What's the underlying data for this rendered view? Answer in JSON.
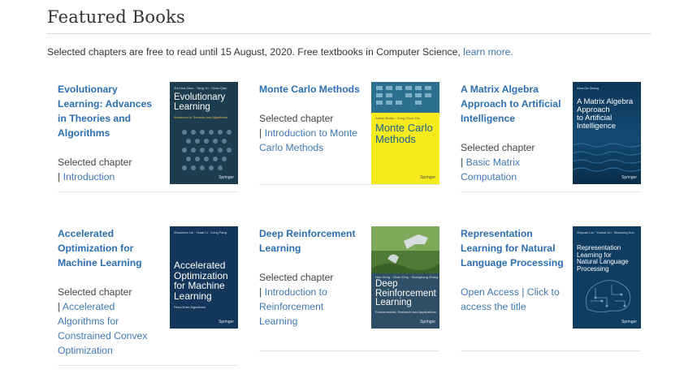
{
  "page": {
    "title": "Featured Books",
    "intro_text": "Selected chapters are free to read until 15 August, 2020.  Free textbooks in Computer Science, ",
    "intro_link": "learn more."
  },
  "books": [
    {
      "title_lines": [
        "Evolutionary",
        "Learning: Advances",
        "in Theories and",
        "Algorithms"
      ],
      "prefix": "Selected chapter",
      "pipe": "| ",
      "link_lines": [
        "Introduction"
      ],
      "cover": {
        "authors": "Zhi-Hua Zhou · Yang Yu · Chao Qian",
        "title_lines": [
          "Evolutionary",
          "Learning"
        ],
        "subtitle": "Advances in Theories and Algorithms",
        "publisher": "Springer",
        "color": "#1d3c4e",
        "icon": "evolutionary-dots-pattern"
      }
    },
    {
      "title_lines": [
        "Monte Carlo Methods"
      ],
      "prefix": "Selected chapter",
      "pipe": "| ",
      "link_lines": [
        "Introduction to Monte",
        "Carlo Methods"
      ],
      "cover": {
        "authors": "Adrian Barbu · Song-Chun Zhu",
        "title_lines": [
          "Monte Carlo",
          "Methods"
        ],
        "subtitle": "",
        "publisher": "Springer",
        "color": "#f5ea1c",
        "icon": "blue-grid-pattern"
      }
    },
    {
      "title_lines": [
        "A Matrix Algebra",
        "Approach to Artificial",
        "Intelligence"
      ],
      "prefix": "Selected chapter",
      "pipe": "| ",
      "link_lines": [
        "Basic Matrix",
        "Computation"
      ],
      "cover": {
        "authors": "Xian-Da Zhang",
        "title_lines": [
          "A Matrix Algebra",
          "Approach",
          "to Artificial",
          "Intelligence"
        ],
        "subtitle": "",
        "publisher": "Springer",
        "color": "#0f3f63",
        "icon": "ocean-waves-image"
      }
    },
    {
      "title_lines": [
        "Accelerated",
        "Optimization for",
        "Machine Learning"
      ],
      "prefix": "Selected  chapter",
      "pipe": "| ",
      "link_lines": [
        "Accelerated",
        "Algorithms for",
        "Constrained Convex",
        "Optimization"
      ],
      "cover": {
        "authors": "Zhouchen Lin · Huan Li · Cong Fang",
        "title_lines": [
          "Accelerated",
          "Optimization",
          "for Machine",
          "Learning"
        ],
        "subtitle": "First-Order Algorithms",
        "publisher": "Springer",
        "color": "#14365a",
        "icon": "plain-cover"
      }
    },
    {
      "title_lines": [
        "Deep Reinforcement",
        "Learning"
      ],
      "prefix": "Selected  chapter",
      "pipe": "| ",
      "link_lines": [
        "Introduction to",
        "Reinforcement",
        "Learning"
      ],
      "cover": {
        "authors": "Hao Dong · Zihan Ding · Shanghang Zhang",
        "title_lines": [
          "Deep",
          "Reinforcement",
          "Learning"
        ],
        "subtitle": "Fundamentals, Research and Applications",
        "publisher": "Springer",
        "color": "#2f4f66",
        "icon": "robot-hand-image"
      }
    },
    {
      "title_lines": [
        "Representation",
        "Learning for Natural",
        "Language Processing"
      ],
      "prefix": "Open Access",
      "pipe": " |  ",
      "link_lines": [
        "Click to",
        "access the title"
      ],
      "cover": {
        "authors": "Zhiyuan Liu · Yankai Lin · Maosong Sun",
        "title_lines": [
          "Representation",
          "Learning for",
          "Natural Language",
          "Processing"
        ],
        "subtitle": "",
        "publisher": "Springer",
        "color": "#0f3d62",
        "icon": "circuit-brain-image"
      }
    }
  ]
}
